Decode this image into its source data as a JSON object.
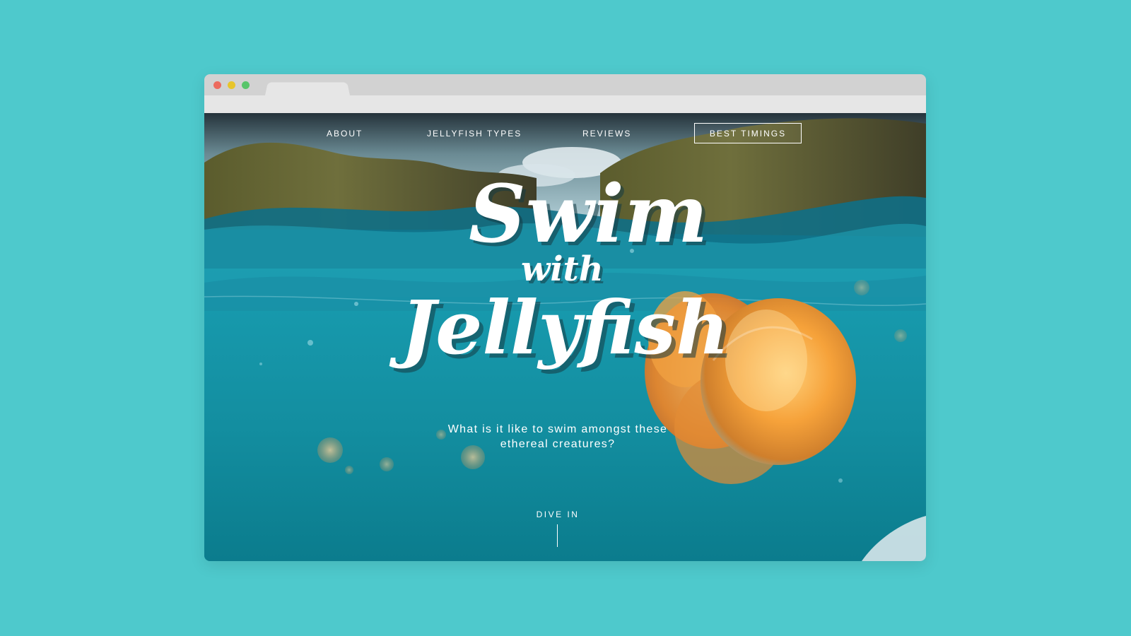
{
  "browser": {
    "window_controls": [
      "close",
      "minimize",
      "maximize"
    ]
  },
  "nav": {
    "items": [
      "ABOUT",
      "JELLYFISH TYPES",
      "REVIEWS"
    ],
    "cta": "BEST TIMINGS"
  },
  "hero": {
    "title_line1": "Swim",
    "title_line2": "with",
    "title_line3": "Jellyfish",
    "subtitle_line1": "What is it like to swim amongst these",
    "subtitle_line2": "ethereal creatures?",
    "dive_label": "DIVE IN"
  },
  "colors": {
    "background": "#4ec9cc",
    "water": "#138ea0",
    "jellyfish": "#f39a2a",
    "text": "#ffffff"
  },
  "icons": {
    "close": "traffic-light-red",
    "minimize": "traffic-light-yellow",
    "maximize": "traffic-light-green"
  }
}
